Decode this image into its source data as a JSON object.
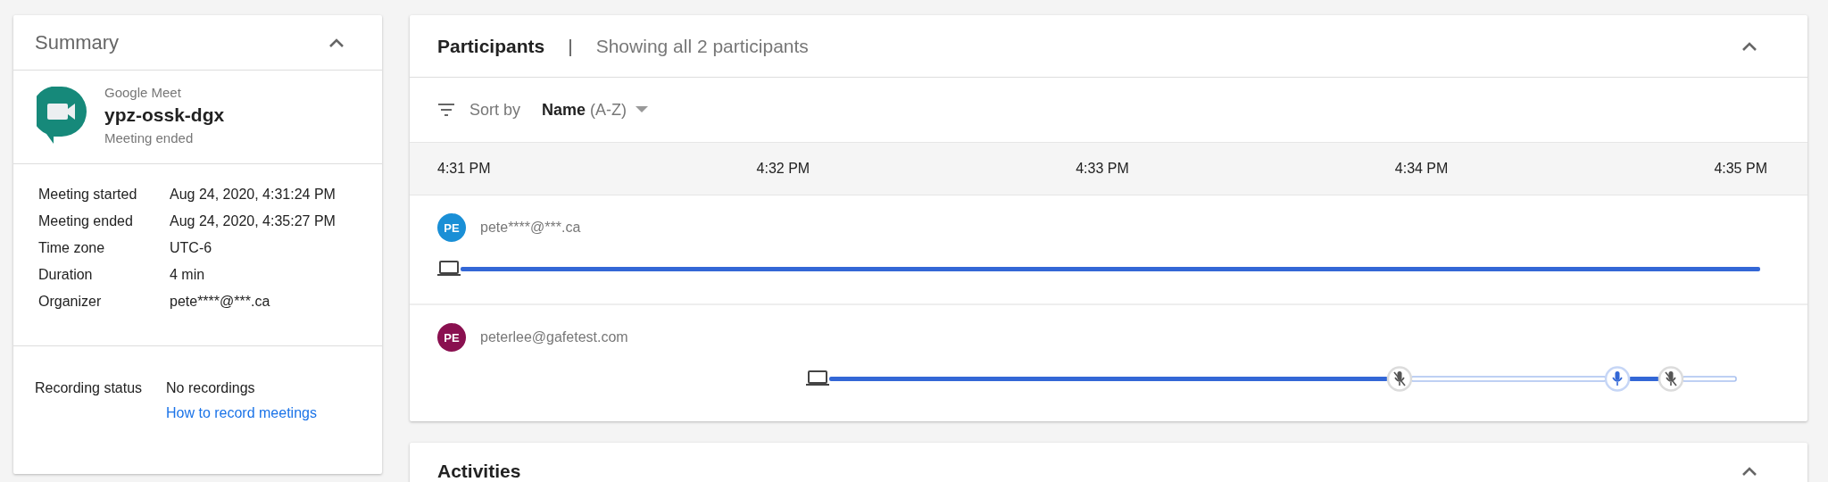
{
  "summary": {
    "title": "Summary",
    "expanded": true,
    "meeting": {
      "app": "Google Meet",
      "code": "ypz-ossk-dgx",
      "status": "Meeting ended"
    },
    "details": [
      {
        "label": "Meeting started",
        "value": "Aug 24, 2020, 4:31:24 PM"
      },
      {
        "label": "Meeting ended",
        "value": "Aug 24, 2020, 4:35:27 PM"
      },
      {
        "label": "Time zone",
        "value": "UTC-6"
      },
      {
        "label": "Duration",
        "value": "4 min"
      },
      {
        "label": "Organizer",
        "value": "pete****@***.ca"
      }
    ],
    "recording": {
      "label": "Recording status",
      "value": "No recordings",
      "link": "How to record meetings"
    }
  },
  "participants": {
    "title": "Participants",
    "separator": "|",
    "subtitle": "Showing all 2 participants",
    "expanded": true,
    "sort": {
      "label": "Sort by",
      "value": "**Name** (A-Z)"
    },
    "time_axis": [
      "4:31 PM",
      "4:32 PM",
      "4:33 PM",
      "4:34 PM",
      "4:35 PM"
    ],
    "rows": [
      {
        "initials": "PE",
        "color": "#1a8fd6",
        "email": "pete****@***.ca",
        "events": []
      },
      {
        "initials": "PE",
        "color": "#8a1050",
        "email": "peterlee@gafetest.com",
        "events": [
          {
            "kind": "muted"
          },
          {
            "kind": "unmuted"
          },
          {
            "kind": "muted"
          }
        ]
      }
    ]
  },
  "activities": {
    "title": "Activities",
    "expanded": true
  }
}
